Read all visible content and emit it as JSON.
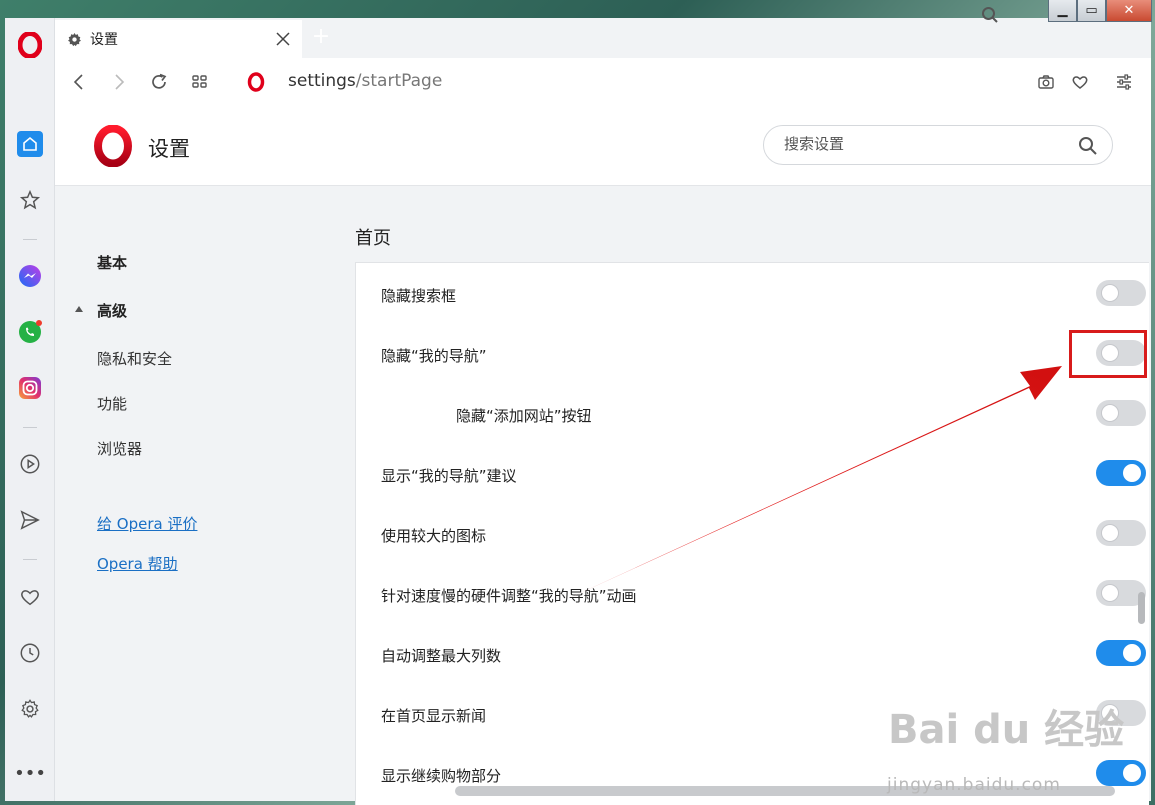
{
  "tab": {
    "label": "设置"
  },
  "address": {
    "url_host": "settings",
    "url_path": "/startPage"
  },
  "settings": {
    "title": "设置",
    "search_placeholder": "搜索设置"
  },
  "leftnav": {
    "basic": "基本",
    "advanced": "高级",
    "items": [
      "隐私和安全",
      "功能",
      "浏览器"
    ],
    "links": [
      "给 Opera 评价",
      "Opera 帮助"
    ]
  },
  "section": {
    "title": "首页",
    "rows": [
      {
        "label": "隐藏搜索框",
        "on": false
      },
      {
        "label": "隐藏“我的导航”",
        "on": false
      },
      {
        "label": "隐藏“添加网站”按钮",
        "on": false
      },
      {
        "label": "显示“我的导航”建议",
        "on": true
      },
      {
        "label": "使用较大的图标",
        "on": false
      },
      {
        "label": "针对速度慢的硬件调整“我的导航”动画",
        "on": false
      },
      {
        "label": "自动调整最大列数",
        "on": true
      },
      {
        "label": "在首页显示新闻",
        "on": false
      },
      {
        "label": "显示继续购物部分",
        "on": true
      }
    ]
  },
  "watermark": {
    "logo": "Bai du 经验",
    "domain": "jingyan.baidu.com"
  },
  "colors": {
    "accent": "#1f8ceb",
    "opera_red": "#e0001b",
    "annotation_red": "#d81b1b"
  }
}
